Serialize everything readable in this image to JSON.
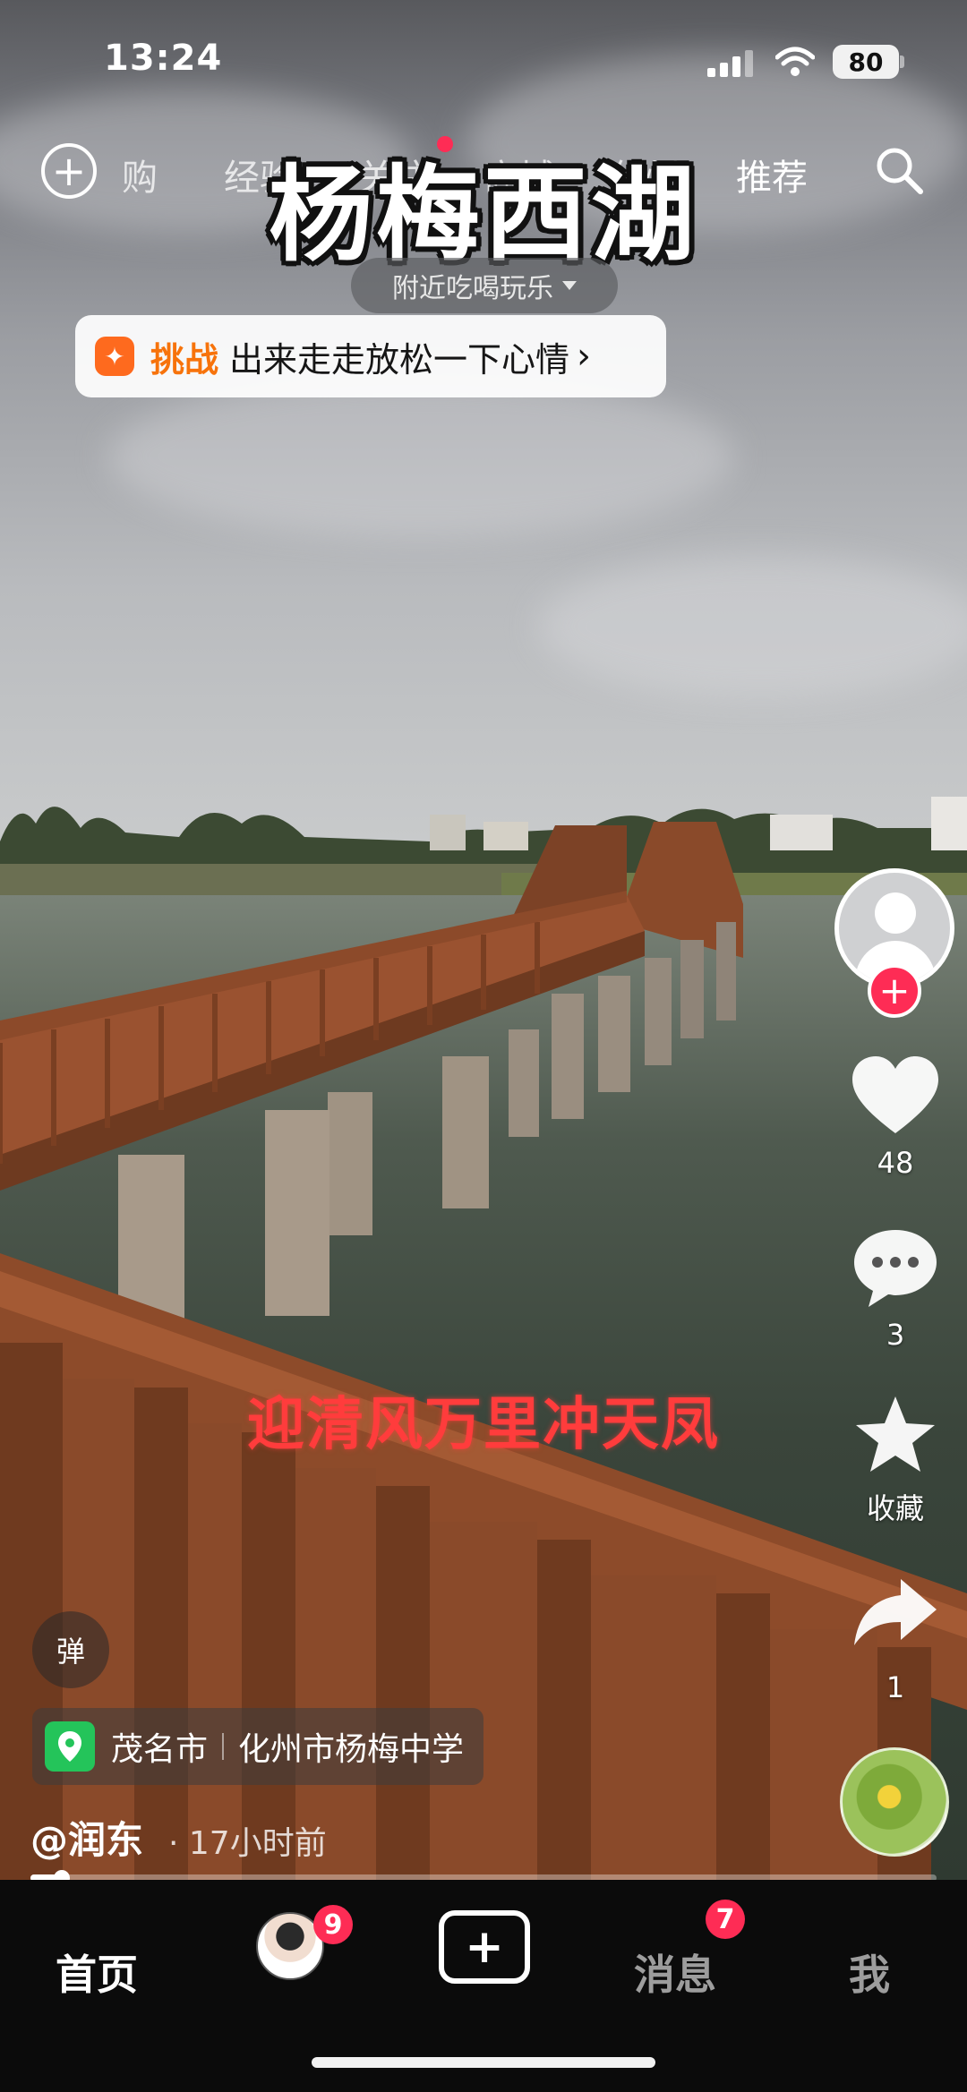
{
  "status_bar": {
    "time": "13:24",
    "battery": "80"
  },
  "top_nav": {
    "tabs": [
      "购",
      "经验",
      "关注",
      "商城",
      "化州",
      "推荐"
    ],
    "active_tab": "推荐"
  },
  "video": {
    "overlay_title": "杨梅西湖",
    "category_pill": "附近吃喝玩乐",
    "challenge": {
      "tag": "挑战",
      "text": "出来走走放松一下心情"
    },
    "subtitle": "迎清风万里冲天凤",
    "author": "@润东",
    "posted": "· 17小时前",
    "progress": 0.03
  },
  "location": {
    "city": "茂名市",
    "place": "化州市杨梅中学"
  },
  "danmu_label": "弹",
  "right_rail": {
    "likes": "48",
    "comments": "3",
    "favorite_label": "收藏",
    "shares": "1"
  },
  "tab_bar": {
    "home": "首页",
    "friends_badge": "9",
    "messages": "消息",
    "messages_badge": "7",
    "me": "我"
  },
  "colors": {
    "accent": "#fe2c55",
    "challenge": "#f7730b",
    "subtitle": "#ff3c3c",
    "location_pin": "#24c45a"
  }
}
